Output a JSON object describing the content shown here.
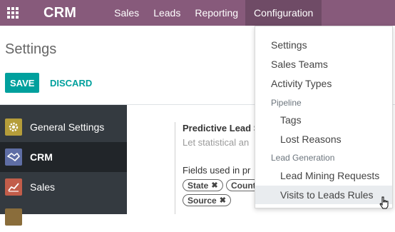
{
  "navbar": {
    "brand": "CRM",
    "menus": [
      "Sales",
      "Leads",
      "Reporting",
      "Configuration"
    ],
    "active_menu": "Configuration",
    "bg_color": "#875a7b"
  },
  "control_panel": {
    "title": "Settings",
    "save_label": "SAVE",
    "discard_label": "DISCARD",
    "accent_color": "#00a09d"
  },
  "sidebar": {
    "items": [
      {
        "label": "General Settings",
        "icon": "gear-icon"
      },
      {
        "label": "CRM",
        "icon": "handshake-icon",
        "active": true
      },
      {
        "label": "Sales",
        "icon": "chart-icon"
      }
    ]
  },
  "setting": {
    "title": "Predictive Lead S",
    "description": "Let statistical an",
    "fields_label": "Fields used in pr",
    "tags": [
      "State",
      "Count",
      "Source"
    ]
  },
  "dropdown": {
    "items": [
      {
        "label": "Settings"
      },
      {
        "label": "Sales Teams"
      },
      {
        "label": "Activity Types"
      }
    ],
    "section_pipeline": "Pipeline",
    "pipeline_items": [
      "Tags",
      "Lost Reasons"
    ],
    "section_lead_generation": "Lead Generation",
    "lead_generation_items": [
      "Lead Mining Requests",
      "Visits to Leads Rules"
    ],
    "hovered_item": "Visits to Leads Rules"
  }
}
